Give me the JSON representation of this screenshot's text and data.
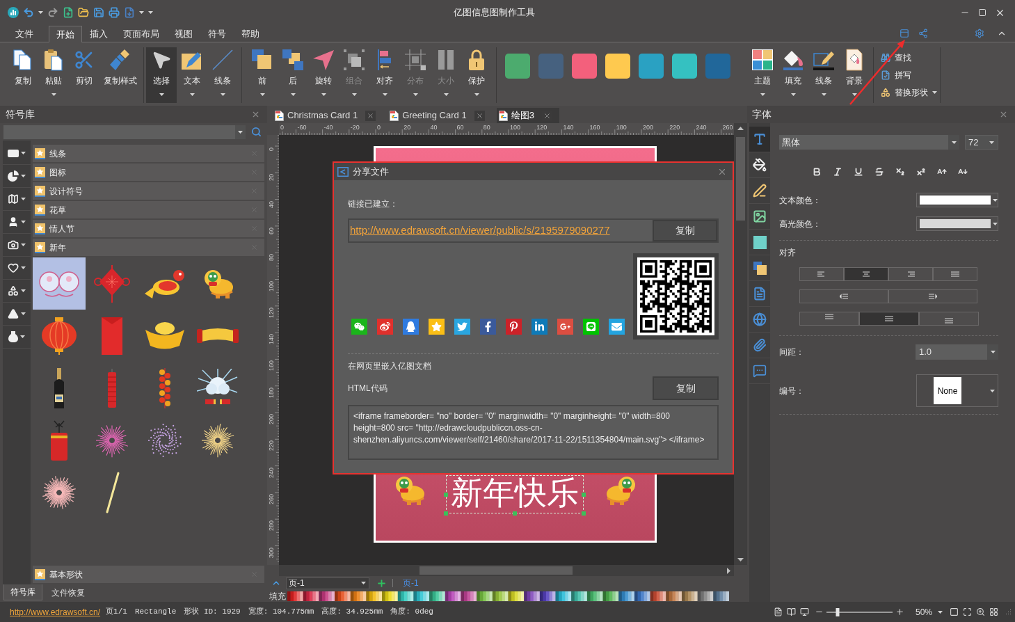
{
  "window": {
    "title": "亿图信息图制作工具"
  },
  "menu_tabs": [
    {
      "label": "文件",
      "selected": false
    },
    {
      "label": "开始",
      "selected": true
    },
    {
      "label": "插入",
      "selected": false
    },
    {
      "label": "页面布局",
      "selected": false
    },
    {
      "label": "视图",
      "selected": false
    },
    {
      "label": "符号",
      "selected": false
    },
    {
      "label": "帮助",
      "selected": false
    }
  ],
  "ribbon": {
    "groups": [
      {
        "items": [
          {
            "kind": "copy",
            "label": "复制",
            "dropdown": false,
            "disabled": false,
            "selected": false
          },
          {
            "kind": "paste",
            "label": "粘贴",
            "dropdown": true,
            "disabled": false,
            "selected": false
          },
          {
            "kind": "cut",
            "label": "剪切",
            "dropdown": false,
            "disabled": false,
            "selected": false
          },
          {
            "kind": "format-painter",
            "label": "复制样式",
            "dropdown": false,
            "disabled": false,
            "selected": false
          }
        ]
      },
      {
        "items": [
          {
            "kind": "select",
            "label": "选择",
            "dropdown": true,
            "disabled": false,
            "selected": true
          },
          {
            "kind": "text",
            "label": "文本",
            "dropdown": true,
            "disabled": false,
            "selected": false
          },
          {
            "kind": "line",
            "label": "线条",
            "dropdown": true,
            "disabled": false,
            "selected": false
          }
        ]
      },
      {
        "items": [
          {
            "kind": "front",
            "label": "前",
            "dropdown": true,
            "disabled": false,
            "selected": false
          },
          {
            "kind": "back",
            "label": "后",
            "dropdown": true,
            "disabled": false,
            "selected": false
          },
          {
            "kind": "rotate",
            "label": "旋转",
            "dropdown": true,
            "disabled": false,
            "selected": false
          },
          {
            "kind": "group",
            "label": "组合",
            "dropdown": true,
            "disabled": true,
            "selected": false
          },
          {
            "kind": "align",
            "label": "对齐",
            "dropdown": true,
            "disabled": false,
            "selected": false
          },
          {
            "kind": "distribute",
            "label": "分布",
            "dropdown": true,
            "disabled": true,
            "selected": false
          },
          {
            "kind": "size",
            "label": "大小",
            "dropdown": true,
            "disabled": true,
            "selected": false
          },
          {
            "kind": "protect",
            "label": "保护",
            "dropdown": true,
            "disabled": false,
            "selected": false
          }
        ]
      }
    ],
    "swatches": [
      {
        "color": "#4cab6e"
      },
      {
        "color": "#46617f"
      },
      {
        "color": "#f3607c"
      },
      {
        "color": "#fec94f"
      },
      {
        "color": "#2aa1c2"
      },
      {
        "color": "#35c1c1"
      },
      {
        "color": "#21679a"
      }
    ],
    "style_items": [
      {
        "kind": "theme",
        "label": "主题",
        "dropdown": true,
        "disabled": false,
        "selected": false
      },
      {
        "kind": "fill",
        "label": "填充",
        "dropdown": true,
        "disabled": false,
        "selected": false
      },
      {
        "kind": "line-style",
        "label": "线条",
        "dropdown": true,
        "disabled": false,
        "selected": false
      },
      {
        "kind": "background",
        "label": "背景",
        "dropdown": true,
        "disabled": false,
        "selected": false
      }
    ],
    "edit_items": [
      {
        "kind": "find",
        "label": "查找",
        "dropdown": false
      },
      {
        "kind": "spelling",
        "label": "拼写",
        "dropdown": false
      },
      {
        "kind": "replace-shape",
        "label": "替换形状",
        "dropdown": true
      }
    ]
  },
  "symbol_library": {
    "title": "符号库",
    "categories": [
      {
        "label": "线条"
      },
      {
        "label": "图标"
      },
      {
        "label": "设计符号"
      },
      {
        "label": "花草"
      },
      {
        "label": "情人节"
      },
      {
        "label": "新年",
        "symbols": [
          {
            "kind": "ornament",
            "selected": true
          },
          {
            "kind": "knot",
            "selected": false
          },
          {
            "kind": "koi",
            "selected": false
          },
          {
            "kind": "lion",
            "selected": false
          },
          {
            "kind": "lantern",
            "selected": false
          },
          {
            "kind": "envelope",
            "selected": false
          },
          {
            "kind": "ingot",
            "selected": false
          },
          {
            "kind": "scroll",
            "selected": false
          },
          {
            "kind": "champagne",
            "selected": false
          },
          {
            "kind": "firecracker",
            "selected": false
          },
          {
            "kind": "firecracker-string",
            "selected": false
          },
          {
            "kind": "burst",
            "selected": false
          },
          {
            "kind": "firework-tube",
            "selected": false
          },
          {
            "kind": "firework-pink",
            "selected": false
          },
          {
            "kind": "firework-purple",
            "selected": false
          },
          {
            "kind": "firework-gold",
            "selected": false
          },
          {
            "kind": "firework-peach",
            "selected": false
          },
          {
            "kind": "spark-trail",
            "selected": false
          }
        ]
      },
      {
        "label": "基本形状"
      }
    ],
    "bottom_tabs": [
      {
        "label": "符号库",
        "selected": true
      },
      {
        "label": "文件恢复",
        "selected": false
      }
    ]
  },
  "documents": {
    "tabs": [
      {
        "label": "Christmas Card 1",
        "selected": false
      },
      {
        "label": "Greeting Card 1",
        "selected": false
      },
      {
        "label": "绘图3",
        "selected": true
      }
    ]
  },
  "ruler": {
    "horizontal": [
      "0",
      "-60",
      "-40",
      "-20",
      "0",
      "20",
      "40",
      "60",
      "80",
      "100",
      "120",
      "140",
      "160",
      "180",
      "200",
      "220",
      "240",
      "260"
    ],
    "vertical": [
      "0",
      "20",
      "40",
      "60",
      "80",
      "100",
      "120",
      "140",
      "160",
      "180",
      "200",
      "220",
      "240",
      "260",
      "280",
      "300"
    ]
  },
  "canvas": {
    "page_text": "新年快乐",
    "text_selected": true
  },
  "page_bar": {
    "current_page": "页-1",
    "tabs": [
      {
        "label": "页-1",
        "selected": true
      }
    ],
    "fill_label": "填充"
  },
  "share_dialog": {
    "title": "分享文件",
    "link_label": "链接已建立：",
    "link": "http://www.edrawsoft.cn/viewer/public/s/2195979090277",
    "copy_button": "复制",
    "share_targets": [
      {
        "kind": "wechat"
      },
      {
        "kind": "weibo"
      },
      {
        "kind": "qq"
      },
      {
        "kind": "qzone"
      },
      {
        "kind": "twitter"
      },
      {
        "kind": "facebook"
      },
      {
        "kind": "pinterest"
      },
      {
        "kind": "linkedin"
      },
      {
        "kind": "google-plus"
      },
      {
        "kind": "line"
      },
      {
        "kind": "email"
      }
    ],
    "embed_title": "在网页里嵌入亿图文档",
    "html_label": "HTML代码",
    "html_copy_button": "复制",
    "html_code": "<iframe frameborder= \"no\" border= \"0\" marginwidth= \"0\" marginheight= \"0\" width=800 height=800 src= \"http://edrawcloudpubliccn.oss-cn-shenzhen.aliyuncs.com/viewer/self/21460/share/2017-11-22/1511354804/main.svg\"> </iframe>"
  },
  "font_panel": {
    "title": "字体",
    "tools": [
      {
        "kind": "text",
        "selected": true
      },
      {
        "kind": "fill",
        "selected": false
      },
      {
        "kind": "line",
        "selected": false
      },
      {
        "kind": "image",
        "selected": false
      },
      {
        "kind": "shape",
        "selected": false
      },
      {
        "kind": "arrange",
        "selected": false
      },
      {
        "kind": "list",
        "selected": false
      },
      {
        "kind": "hyperlink",
        "selected": false
      },
      {
        "kind": "attachment",
        "selected": false
      },
      {
        "kind": "comment",
        "selected": false
      }
    ],
    "font": "黑体",
    "size": "72",
    "format_buttons": [
      {
        "kind": "bold"
      },
      {
        "kind": "italic"
      },
      {
        "kind": "underline"
      },
      {
        "kind": "strikethrough"
      },
      {
        "kind": "subscript"
      },
      {
        "kind": "superscript"
      },
      {
        "kind": "grow"
      },
      {
        "kind": "shrink"
      }
    ],
    "text_color": {
      "label": "文本颜色：",
      "color": "#ffffff"
    },
    "highlight_color": {
      "label": "高光颜色：",
      "color": "#d9d9d9"
    },
    "alignment": {
      "label": "对齐",
      "horizontal": [
        {
          "kind": "left",
          "selected": false
        },
        {
          "kind": "center",
          "selected": true
        },
        {
          "kind": "right",
          "selected": false
        },
        {
          "kind": "justify",
          "selected": false
        }
      ],
      "indent": [
        {
          "kind": "decrease",
          "selected": false
        },
        {
          "kind": "increase",
          "selected": false
        }
      ],
      "vertical": [
        {
          "kind": "top",
          "selected": false
        },
        {
          "kind": "middle",
          "selected": true
        },
        {
          "kind": "bottom",
          "selected": false
        }
      ]
    },
    "spacing": {
      "label": "间距：",
      "value": "1.0"
    },
    "numbering": {
      "label": "编号：",
      "value": "None"
    }
  },
  "status_bar": {
    "link": "http://www.edrawsoft.cn/",
    "items": [
      "页1/1",
      "Rectangle",
      "形状 ID: 1929",
      "宽度: 104.775mm",
      "高度: 34.925mm",
      "角度: 0deg"
    ],
    "zoom": {
      "level": 0.17,
      "reading": "50%"
    }
  }
}
